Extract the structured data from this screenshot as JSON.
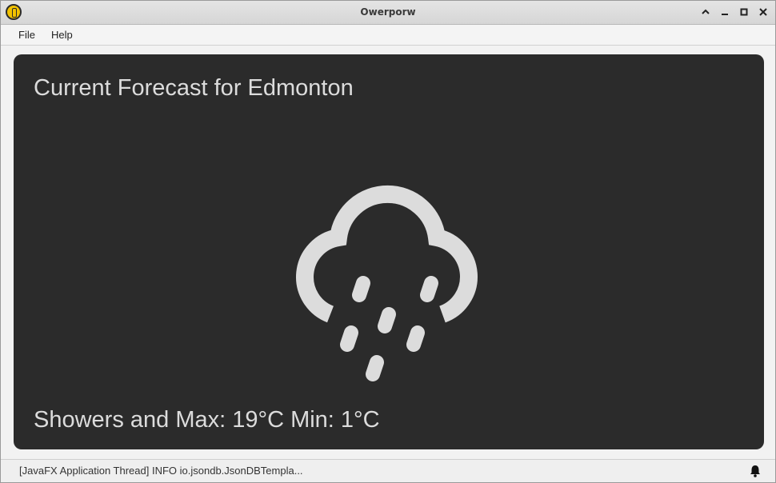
{
  "window": {
    "title": "Owerporw",
    "app_icon": "app-logo-icon",
    "controls": [
      "chevron-up-icon",
      "minimize-icon",
      "maximize-icon",
      "close-icon"
    ]
  },
  "menu": {
    "items": [
      {
        "label": "File"
      },
      {
        "label": "Help"
      }
    ]
  },
  "forecast": {
    "heading": "Current Forecast for Edmonton",
    "icon": "rain-showers-icon",
    "summary": "Showers and Max: 19°C Min: 1°C"
  },
  "status": {
    "text": "[JavaFX Application Thread] INFO io.jsondb.JsonDBTempla...",
    "icon": "bell-icon"
  },
  "colors": {
    "panel_bg": "#2b2b2b",
    "text": "#dcdcdc",
    "icon_fill": "#dcdcdc"
  }
}
